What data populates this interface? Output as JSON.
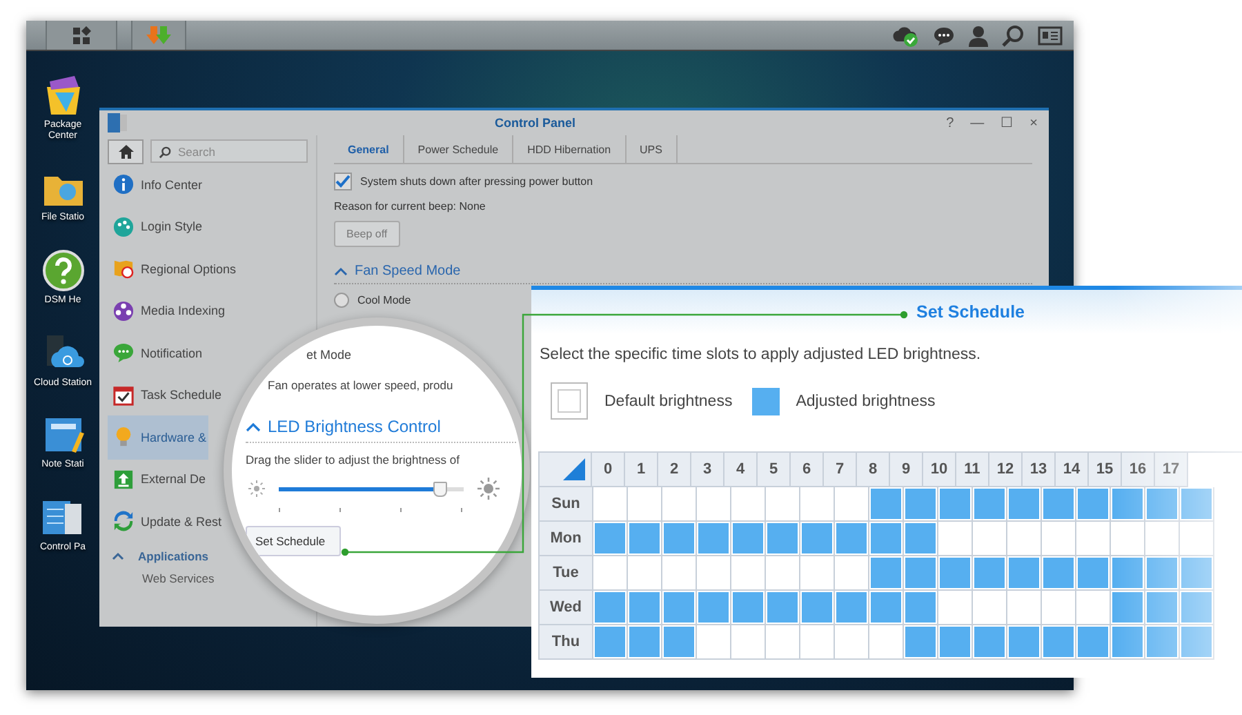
{
  "desktop": {
    "icons": [
      {
        "label": "Package Center",
        "kind": "bag"
      },
      {
        "label": "File Statio",
        "kind": "folder"
      },
      {
        "label": "DSM He",
        "kind": "help"
      },
      {
        "label": "Cloud Station",
        "kind": "cloud"
      },
      {
        "label": "Note Stati",
        "kind": "note"
      },
      {
        "label": "Control Pa",
        "kind": "panel"
      }
    ]
  },
  "window": {
    "title": "Control Panel",
    "controls": [
      "?",
      "—",
      "☐",
      "×"
    ]
  },
  "sidebar": {
    "search": {
      "placeholder": "Search"
    },
    "items": [
      {
        "label": "Info Center",
        "kind": "info",
        "selected": false
      },
      {
        "label": "Login Style",
        "kind": "palette",
        "selected": false
      },
      {
        "label": "Regional Options",
        "kind": "map",
        "selected": false
      },
      {
        "label": "Media Indexing",
        "kind": "film",
        "selected": false
      },
      {
        "label": "Notification",
        "kind": "chat",
        "selected": false
      },
      {
        "label": "Task Schedule",
        "kind": "calendar",
        "selected": false
      },
      {
        "label": "Hardware &",
        "kind": "bulb",
        "selected": true
      },
      {
        "label": "External De",
        "kind": "upload",
        "selected": false
      },
      {
        "label": "Update & Rest",
        "kind": "refresh",
        "selected": false
      }
    ],
    "section": {
      "label": "Applications",
      "expanded": true
    },
    "cut_item": {
      "label": "Web Services"
    }
  },
  "tabs": [
    {
      "label": "General",
      "selected": true
    },
    {
      "label": "Power Schedule",
      "selected": false
    },
    {
      "label": "HDD Hibernation",
      "selected": false
    },
    {
      "label": "UPS",
      "selected": false
    }
  ],
  "general": {
    "shutdown": {
      "label": "System shuts down after pressing power button",
      "checked": true
    },
    "beep_reason": "Reason for current beep: None",
    "beep_button": "Beep off",
    "fan_section": {
      "title": "Fan Speed Mode",
      "expanded": true
    },
    "fan_modes": [
      {
        "label": "Cool Mode",
        "selected": false
      }
    ]
  },
  "magnifier": {
    "mode_label": "et Mode",
    "mode_desc": "Fan operates at lower speed, produ",
    "led_section": {
      "title": "LED Brightness Control",
      "expanded": true
    },
    "hint": "Drag the slider to adjust the brightness of",
    "slider": {
      "level": 0.87
    },
    "schedule_button": "Set Schedule"
  },
  "schedule": {
    "title": "Set Schedule",
    "description": "Select the specific time slots to apply adjusted LED brightness.",
    "legend": [
      {
        "label": "Default brightness",
        "kind": "default"
      },
      {
        "label": "Adjusted brightness",
        "kind": "adjusted"
      }
    ],
    "hours": [
      "0",
      "1",
      "2",
      "3",
      "4",
      "5",
      "6",
      "7",
      "8",
      "9",
      "10",
      "11",
      "12",
      "13",
      "14",
      "15",
      "16",
      "17"
    ],
    "rows": [
      {
        "day": "Sun",
        "slots": [
          false,
          false,
          false,
          false,
          false,
          false,
          false,
          false,
          true,
          true,
          true,
          true,
          true,
          true,
          true,
          true,
          true,
          true
        ]
      },
      {
        "day": "Mon",
        "slots": [
          true,
          true,
          true,
          true,
          true,
          true,
          true,
          true,
          true,
          true,
          false,
          false,
          false,
          false,
          false,
          false,
          false,
          false
        ]
      },
      {
        "day": "Tue",
        "slots": [
          false,
          false,
          false,
          false,
          false,
          false,
          false,
          false,
          true,
          true,
          true,
          true,
          true,
          true,
          true,
          true,
          true,
          true
        ]
      },
      {
        "day": "Wed",
        "slots": [
          true,
          true,
          true,
          true,
          true,
          true,
          true,
          true,
          true,
          true,
          false,
          false,
          false,
          false,
          false,
          true,
          true,
          true
        ]
      },
      {
        "day": "Thu",
        "slots": [
          true,
          true,
          true,
          false,
          false,
          false,
          false,
          false,
          false,
          true,
          true,
          true,
          true,
          true,
          true,
          true,
          true,
          true
        ]
      }
    ]
  }
}
